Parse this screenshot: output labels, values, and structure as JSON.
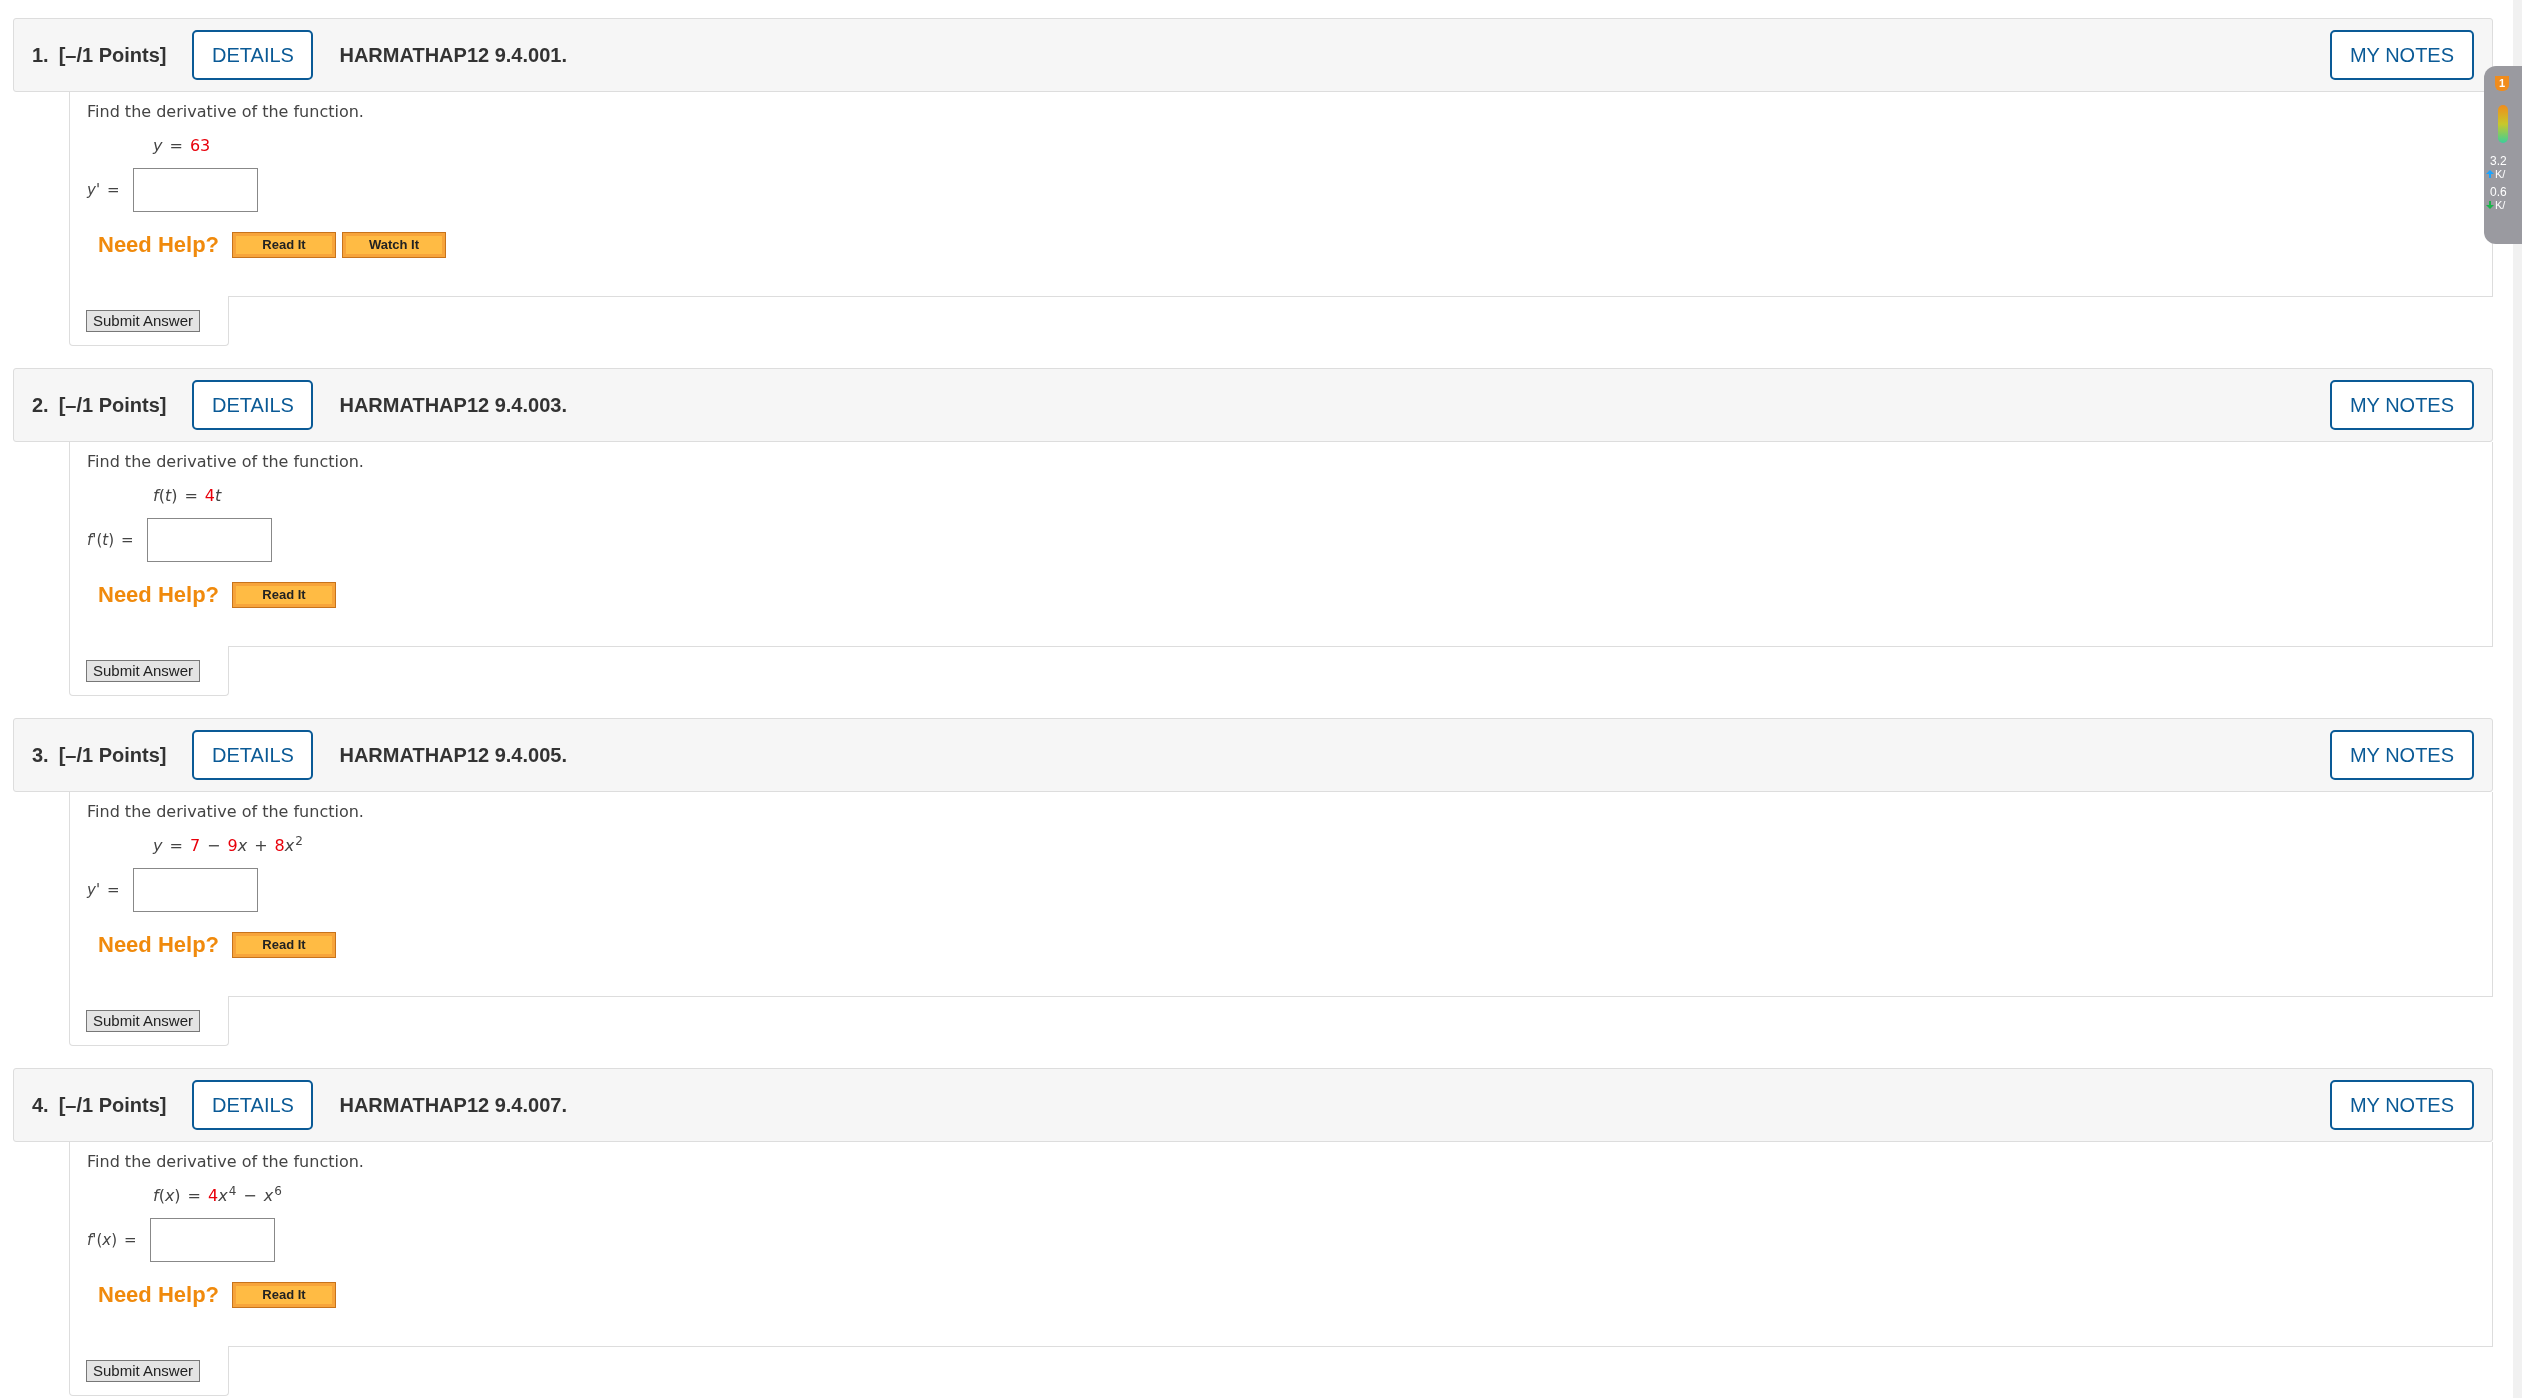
{
  "questions": [
    {
      "number": "1.",
      "points": "[–/1 Points]",
      "details": "DETAILS",
      "code": "HARMATHAP12 9.4.001.",
      "my_notes": "MY NOTES",
      "prompt": "Find the derivative of the function.",
      "formula": [
        {
          "kind": "var",
          "text": "y"
        },
        {
          "kind": "op",
          "text": "="
        },
        {
          "kind": "num",
          "text": "63"
        }
      ],
      "answer_label": [
        {
          "kind": "var",
          "text": "y'"
        },
        {
          "kind": "op",
          "text": "="
        }
      ],
      "help_label": "Need Help?",
      "help_buttons": [
        "Read It",
        "Watch It"
      ],
      "submit": "Submit Answer"
    },
    {
      "number": "2.",
      "points": "[–/1 Points]",
      "details": "DETAILS",
      "code": "HARMATHAP12 9.4.003.",
      "my_notes": "MY NOTES",
      "prompt": "Find the derivative of the function.",
      "formula": [
        {
          "kind": "var",
          "text": "f"
        },
        {
          "kind": "paren",
          "text": "("
        },
        {
          "kind": "var",
          "text": "t"
        },
        {
          "kind": "paren",
          "text": ")"
        },
        {
          "kind": "op",
          "text": "="
        },
        {
          "kind": "num",
          "text": "4"
        },
        {
          "kind": "var",
          "text": "t"
        }
      ],
      "answer_label": [
        {
          "kind": "var",
          "text": "f'"
        },
        {
          "kind": "paren",
          "text": "("
        },
        {
          "kind": "var",
          "text": "t"
        },
        {
          "kind": "paren",
          "text": ")"
        },
        {
          "kind": "op",
          "text": "="
        }
      ],
      "help_label": "Need Help?",
      "help_buttons": [
        "Read It"
      ],
      "submit": "Submit Answer"
    },
    {
      "number": "3.",
      "points": "[–/1 Points]",
      "details": "DETAILS",
      "code": "HARMATHAP12 9.4.005.",
      "my_notes": "MY NOTES",
      "prompt": "Find the derivative of the function.",
      "formula": [
        {
          "kind": "var",
          "text": "y"
        },
        {
          "kind": "op",
          "text": "="
        },
        {
          "kind": "num",
          "text": "7"
        },
        {
          "kind": "op",
          "text": "−"
        },
        {
          "kind": "num",
          "text": "9"
        },
        {
          "kind": "var",
          "text": "x"
        },
        {
          "kind": "op",
          "text": "+"
        },
        {
          "kind": "num",
          "text": "8"
        },
        {
          "kind": "var",
          "text": "x"
        },
        {
          "kind": "sup",
          "text": "2"
        }
      ],
      "answer_label": [
        {
          "kind": "var",
          "text": "y'"
        },
        {
          "kind": "op",
          "text": "="
        }
      ],
      "help_label": "Need Help?",
      "help_buttons": [
        "Read It"
      ],
      "submit": "Submit Answer"
    },
    {
      "number": "4.",
      "points": "[–/1 Points]",
      "details": "DETAILS",
      "code": "HARMATHAP12 9.4.007.",
      "my_notes": "MY NOTES",
      "prompt": "Find the derivative of the function.",
      "formula": [
        {
          "kind": "var",
          "text": "f"
        },
        {
          "kind": "paren",
          "text": "("
        },
        {
          "kind": "var",
          "text": "x"
        },
        {
          "kind": "paren",
          "text": ")"
        },
        {
          "kind": "op",
          "text": "="
        },
        {
          "kind": "num",
          "text": "4"
        },
        {
          "kind": "var",
          "text": "x"
        },
        {
          "kind": "sup",
          "text": "4"
        },
        {
          "kind": "op",
          "text": "−"
        },
        {
          "kind": "var",
          "text": "x"
        },
        {
          "kind": "sup",
          "text": "6"
        }
      ],
      "answer_label": [
        {
          "kind": "var",
          "text": "f'"
        },
        {
          "kind": "paren",
          "text": "("
        },
        {
          "kind": "var",
          "text": "x"
        },
        {
          "kind": "paren",
          "text": ")"
        },
        {
          "kind": "op",
          "text": "="
        }
      ],
      "help_label": "Need Help?",
      "help_buttons": [
        "Read It"
      ],
      "submit": "Submit Answer"
    }
  ],
  "speed_widget": {
    "badge": "1",
    "upload": "3.2",
    "upload_unit": "K/",
    "download": "0.6",
    "download_unit": "K/"
  }
}
